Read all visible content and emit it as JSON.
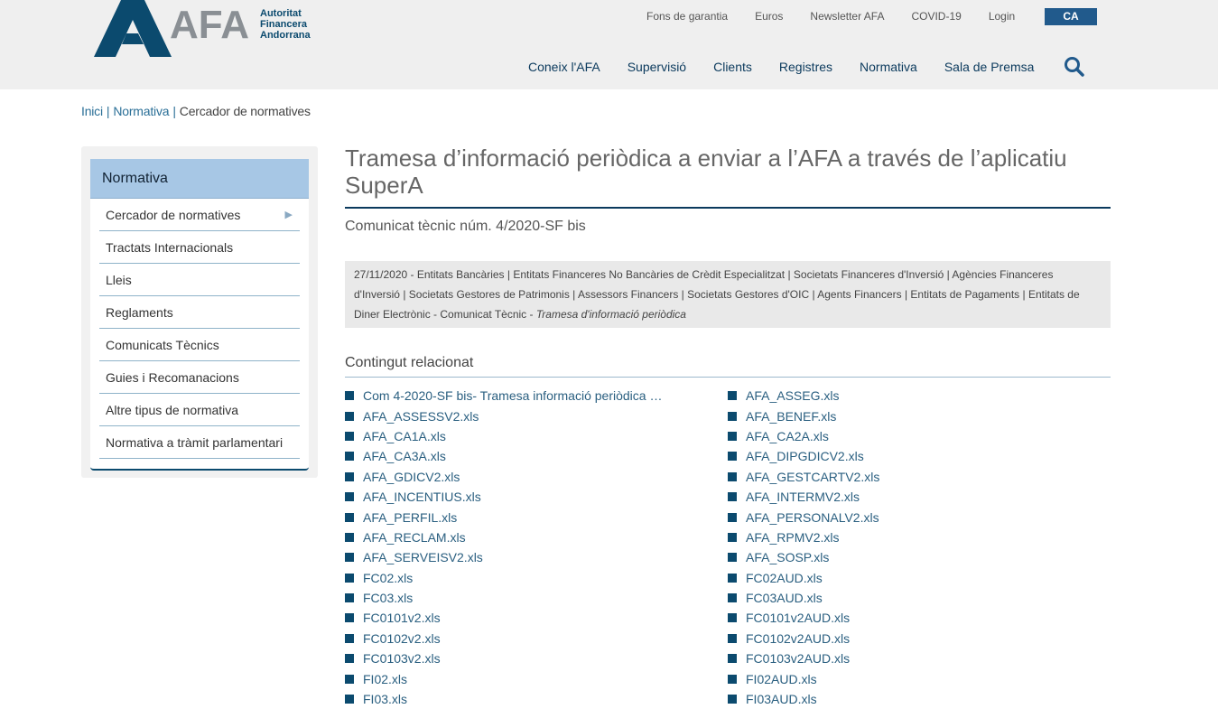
{
  "logo": {
    "mark": "AFA",
    "line1": "Autoritat",
    "line2": "Financera",
    "line3": "Andorrana",
    "color": "#0b4a6e"
  },
  "topnav": [
    "Fons de garantia",
    "Euros",
    "Newsletter AFA",
    "COVID-19",
    "Login"
  ],
  "lang": "CA",
  "mainnav": [
    "Coneix l'AFA",
    "Supervisió",
    "Clients",
    "Registres",
    "Normativa",
    "Sala de Premsa"
  ],
  "breadcrumb": {
    "home": "Inici",
    "section": "Normativa",
    "current": "Cercador de normatives",
    "separator": "|"
  },
  "sidebar": {
    "heading": "Normativa",
    "items": [
      {
        "label": "Cercador de normatives",
        "arrow": "▶"
      },
      {
        "label": "Tractats Internacionals"
      },
      {
        "label": "Lleis"
      },
      {
        "label": "Reglaments"
      },
      {
        "label": "Comunicats Tècnics"
      },
      {
        "label": "Guies i Recomanacions"
      },
      {
        "label": "Altre tipus de normativa"
      },
      {
        "label": "Normativa a tràmit parlamentari"
      }
    ]
  },
  "article": {
    "title": "Tramesa d’informació periòdica a enviar a l’AFA a través de l’aplicatiu SuperA",
    "subtitle": "Comunicat tècnic núm. 4/2020-SF bis",
    "meta_text": "27/11/2020 - Entitats Bancàries | Entitats Financeres No Bancàries de Crèdit Especialitzat | Societats Financeres d'Inversió | Agències Financeres d'Inversió | Societats Gestores de Patrimonis | Assessors Financers | Societats Gestores d'OIC | Agents Financers | Entitats de Pagaments | Entitats de Diner Electrònic - Comunicat Tècnic - ",
    "meta_italic": "Tramesa d'informació periòdica"
  },
  "related": {
    "heading": "Contingut relacionat",
    "left": [
      "Com 4-2020-SF bis- Tramesa informació periòdica Su...",
      "AFA_ASSESSV2.xls",
      "AFA_CA1A.xls",
      "AFA_CA3A.xls",
      "AFA_GDICV2.xls",
      "AFA_INCENTIUS.xls",
      "AFA_PERFIL.xls",
      "AFA_RECLAM.xls",
      "AFA_SERVEISV2.xls",
      "FC02.xls",
      "FC03.xls",
      "FC0101v2.xls",
      "FC0102v2.xls",
      "FC0103v2.xls",
      "FI02.xls",
      "FI03.xls"
    ],
    "right": [
      "AFA_ASSEG.xls",
      "AFA_BENEF.xls",
      "AFA_CA2A.xls",
      "AFA_DIPGDICV2.xls",
      "AFA_GESTCARTV2.xls",
      "AFA_INTERMV2.xls",
      "AFA_PERSONALV2.xls",
      "AFA_RPMV2.xls",
      "AFA_SOSP.xls",
      "FC02AUD.xls",
      "FC03AUD.xls",
      "FC0101v2AUD.xls",
      "FC0102v2AUD.xls",
      "FC0103v2AUD.xls",
      "FI02AUD.xls",
      "FI03AUD.xls"
    ]
  }
}
